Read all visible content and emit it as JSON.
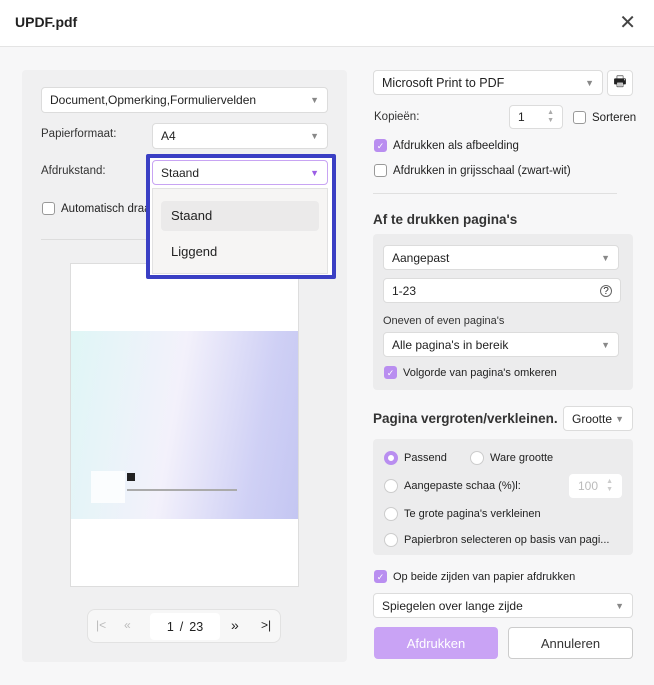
{
  "window": {
    "title": "UPDF.pdf"
  },
  "left": {
    "content_select": "Document,Opmerking,Formuliervelden",
    "paper_label": "Papierformaat:",
    "paper_value": "A4",
    "orientation_label": "Afdrukstand:",
    "orientation_value": "Staand",
    "orientation_options": [
      "Staand",
      "Liggend"
    ],
    "auto_rotate": "Automatisch draaien",
    "pager": {
      "current": "1",
      "separator": "/",
      "total": "23"
    }
  },
  "right": {
    "printer": "Microsoft Print to PDF",
    "copies_label": "Kopieën:",
    "copies": "1",
    "collate": "Sorteren",
    "print_as_image": "Afdrukken als afbeelding",
    "grayscale": "Afdrukken in grijsschaal (zwart-wit)",
    "pages_heading": "Af te drukken pagina's",
    "range_mode": "Aangepast",
    "range": "1-23",
    "odd_even_label": "Oneven of even pagina's",
    "odd_even": "Alle pagina's in bereik",
    "reverse": "Volgorde van pagina's omkeren",
    "scale_heading": "Pagina vergroten/verkleinen.",
    "scale_mode": "Grootte",
    "fit": "Passend",
    "actual": "Ware grootte",
    "custom_scale": "Aangepaste schaa (%)l:",
    "custom_scale_value": "100",
    "shrink": "Te grote pagina's verkleinen",
    "paper_source": "Papierbron selecteren op basis van pagi...",
    "duplex": "Op beide zijden van papier afdrukken",
    "flip": "Spiegelen over lange zijde",
    "print_button": "Afdrukken",
    "cancel_button": "Annuleren"
  },
  "colors": {
    "accent": "#b98ef0",
    "highlight": "#3a3fc4"
  }
}
